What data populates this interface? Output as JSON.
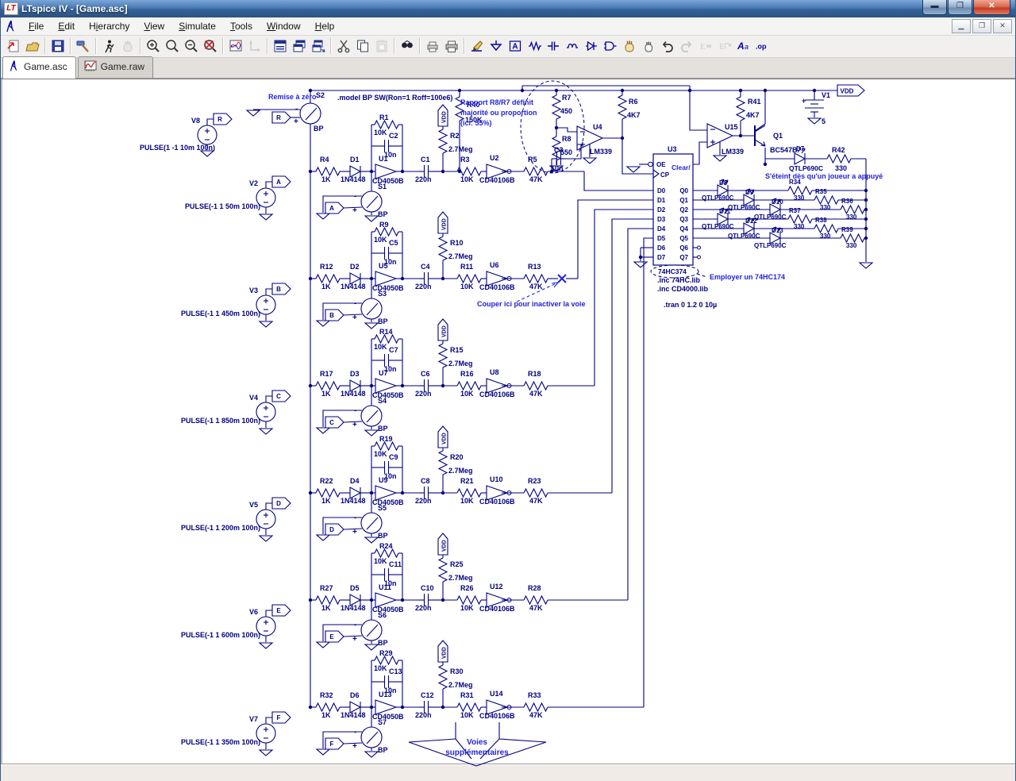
{
  "window": {
    "title": "LTspice IV - [Game.asc]",
    "buttons": [
      "minimize",
      "maximize",
      "close"
    ]
  },
  "menu": {
    "items": [
      {
        "name": "file",
        "pre": "",
        "key": "F",
        "post": "ile"
      },
      {
        "name": "edit",
        "pre": "",
        "key": "E",
        "post": "dit"
      },
      {
        "name": "hierarchy",
        "pre": "H",
        "key": "i",
        "post": "erarchy"
      },
      {
        "name": "view",
        "pre": "",
        "key": "V",
        "post": "iew"
      },
      {
        "name": "simulate",
        "pre": "",
        "key": "S",
        "post": "imulate"
      },
      {
        "name": "tools",
        "pre": "",
        "key": "T",
        "post": "ools"
      },
      {
        "name": "window",
        "pre": "",
        "key": "W",
        "post": "indow"
      },
      {
        "name": "help",
        "pre": "",
        "key": "H",
        "post": "elp"
      }
    ]
  },
  "toolbar": {
    "icons": [
      {
        "n": "new-schematic",
        "e": true
      },
      {
        "n": "open-file",
        "e": true
      },
      {
        "n": "sep"
      },
      {
        "n": "save",
        "e": true
      },
      {
        "n": "sep"
      },
      {
        "n": "control-panel",
        "e": true
      },
      {
        "n": "sep"
      },
      {
        "n": "run-simulation",
        "e": true
      },
      {
        "n": "halt-simulation",
        "e": false
      },
      {
        "n": "sep"
      },
      {
        "n": "zoom-in",
        "e": true
      },
      {
        "n": "zoom-full",
        "e": true
      },
      {
        "n": "zoom-out",
        "e": true
      },
      {
        "n": "zoom-clear",
        "e": true
      },
      {
        "n": "sep"
      },
      {
        "n": "waveform-pane",
        "e": true
      },
      {
        "n": "autorange-y",
        "e": false
      },
      {
        "n": "sep"
      },
      {
        "n": "tile-windows",
        "e": true
      },
      {
        "n": "cascade-windows",
        "e": true
      },
      {
        "n": "arrange-windows",
        "e": true
      },
      {
        "n": "sep"
      },
      {
        "n": "cut",
        "e": true
      },
      {
        "n": "copy",
        "e": true
      },
      {
        "n": "paste",
        "e": false
      },
      {
        "n": "sep"
      },
      {
        "n": "find",
        "e": true
      },
      {
        "n": "sep"
      },
      {
        "n": "print-preview",
        "e": true
      },
      {
        "n": "print",
        "e": true
      },
      {
        "n": "sep"
      },
      {
        "n": "draw-wire",
        "e": true
      },
      {
        "n": "place-ground",
        "e": true
      },
      {
        "n": "place-label",
        "e": true
      },
      {
        "n": "place-resistor",
        "e": true
      },
      {
        "n": "place-capacitor",
        "e": true
      },
      {
        "n": "place-inductor",
        "e": true
      },
      {
        "n": "place-diode",
        "e": true
      },
      {
        "n": "place-component",
        "e": true
      },
      {
        "n": "move",
        "e": true
      },
      {
        "n": "drag",
        "e": true
      },
      {
        "n": "undo",
        "e": true
      },
      {
        "n": "redo",
        "e": false
      },
      {
        "n": "mirror",
        "e": false
      },
      {
        "n": "rotate",
        "e": false
      },
      {
        "n": "place-text",
        "e": true
      },
      {
        "n": "spice-directive",
        "e": true
      }
    ]
  },
  "tabs": [
    {
      "label": "Game.asc",
      "icon": "schematic-icon",
      "active": true
    },
    {
      "label": "Game.raw",
      "icon": "waveform-icon",
      "active": false
    }
  ],
  "schematic": {
    "reset": {
      "src": "V8",
      "pulse": "PULSE(1 -1 10m 100n)",
      "port": "R",
      "sw": "S2",
      "sw_val": "BP",
      "res": "R40",
      "res_val": "150K",
      "comment": "Remise à zéro",
      "model": ".model BP SW(Ron=1 Roff=100e6)"
    },
    "row_values": {
      "rin": "1K",
      "din": "1N4148",
      "buf": "CD4050B",
      "fbr": "10K",
      "fbc": "10n",
      "pull": "2.7Meg",
      "cap": "220n",
      "rmid": "10K",
      "inv": "CD40106B",
      "rout": "47K",
      "sw": "BP"
    },
    "rows": [
      {
        "port": "A",
        "src": "V2",
        "pulse": "PULSE(-1 1 50m 100n)",
        "rin": "R4",
        "din": "D1",
        "buf": "U1",
        "fbr": "R1",
        "fbc": "C2",
        "pull": "R2",
        "cap": "C1",
        "rmid": "R3",
        "inv": "U2",
        "rout": "R5",
        "sw": "S1"
      },
      {
        "port": "B",
        "src": "V3",
        "pulse": "PULSE(-1 1 450m 100n)",
        "rin": "R12",
        "din": "D2",
        "buf": "U5",
        "fbr": "R9",
        "fbc": "C5",
        "pull": "R10",
        "cap": "C4",
        "rmid": "R11",
        "inv": "U6",
        "rout": "R13",
        "sw": "S3"
      },
      {
        "port": "C",
        "src": "V4",
        "pulse": "PULSE(-1 1 850m 100n)",
        "rin": "R17",
        "din": "D3",
        "buf": "U7",
        "fbr": "R14",
        "fbc": "C7",
        "pull": "R15",
        "cap": "C6",
        "rmid": "R16",
        "inv": "U8",
        "rout": "R18",
        "sw": "S4"
      },
      {
        "port": "D",
        "src": "V5",
        "pulse": "PULSE(-1 1 200m 100n)",
        "rin": "R22",
        "din": "D4",
        "buf": "U9",
        "fbr": "R19",
        "fbc": "C9",
        "pull": "R20",
        "cap": "C8",
        "rmid": "R21",
        "inv": "U10",
        "rout": "R23",
        "sw": "S5"
      },
      {
        "port": "E",
        "src": "V6",
        "pulse": "PULSE(-1 1 600m 100n)",
        "rin": "R27",
        "din": "D5",
        "buf": "U11",
        "fbr": "R24",
        "fbc": "C11",
        "pull": "R25",
        "cap": "C10",
        "rmid": "R26",
        "inv": "U12",
        "rout": "R28",
        "sw": "S6"
      },
      {
        "port": "F",
        "src": "V7",
        "pulse": "PULSE(-1 1 350m 100n)",
        "rin": "R32",
        "din": "D6",
        "buf": "U13",
        "fbr": "R29",
        "fbc": "C13",
        "pull": "R30",
        "cap": "C12",
        "rmid": "R31",
        "inv": "U14",
        "rout": "R33",
        "sw": "S7"
      }
    ],
    "comparator": {
      "u4": "U4",
      "u4_val": "LM339",
      "r6": "R6",
      "r6_val": "4K7",
      "r7": "R7",
      "r7_val": "450",
      "r8": "R8",
      "r8_val": "550",
      "c3": "C3",
      "c3_val": "10n",
      "divider_comment": [
        "Rapport R8/R7 définit",
        "majorité ou proportion",
        "(ici: 55%)"
      ]
    },
    "output": {
      "u15": "U15",
      "u15_val": "LM339",
      "r41": "R41",
      "r41_val": "4K7",
      "q1": "Q1",
      "q1_val": "BC547B",
      "v1": "V1",
      "v1_val": "5",
      "v1_plus": "+",
      "vdd": "VDD",
      "led": "D7",
      "led_val": "QTLP690C",
      "r42": "R42",
      "r42_val": "330",
      "comment": "S'éteint dès qu'un joueur a appuyé"
    },
    "register": {
      "u3": "U3",
      "part": "74HC374",
      "clear": "Clear/",
      "oe": "OE",
      "cp": "CP",
      "din": [
        "D0",
        "D1",
        "D2",
        "D3",
        "D4",
        "D5",
        "D6",
        "D7"
      ],
      "qout": [
        "Q0",
        "Q1",
        "Q2",
        "Q3",
        "Q4",
        "Q5",
        "Q6",
        "Q7"
      ],
      "comment": "Employer un 74HC174",
      "led_val": "QTLP690C",
      "led_r_val": "330",
      "leds": [
        {
          "d": "D8",
          "r": "R34"
        },
        {
          "d": "D9",
          "r": "R35"
        },
        {
          "d": "D10",
          "r": "R36"
        },
        {
          "d": "D11",
          "r": "R37"
        },
        {
          "d": "D12",
          "r": "R38"
        },
        {
          "d": "D13",
          "r": "R39"
        }
      ]
    },
    "directives": [
      ".inc 74HC.lib",
      ".inc CD4000.lib",
      ".tran 0 1.2 0 10µ"
    ],
    "cut_comment": "Couper ici pour inactiver la voie",
    "more_comment": [
      "Voies",
      "supplémentaires"
    ],
    "colors": {
      "wire": "#000080",
      "comment": "#2222dd"
    }
  },
  "statusbar": {
    "text": ""
  }
}
